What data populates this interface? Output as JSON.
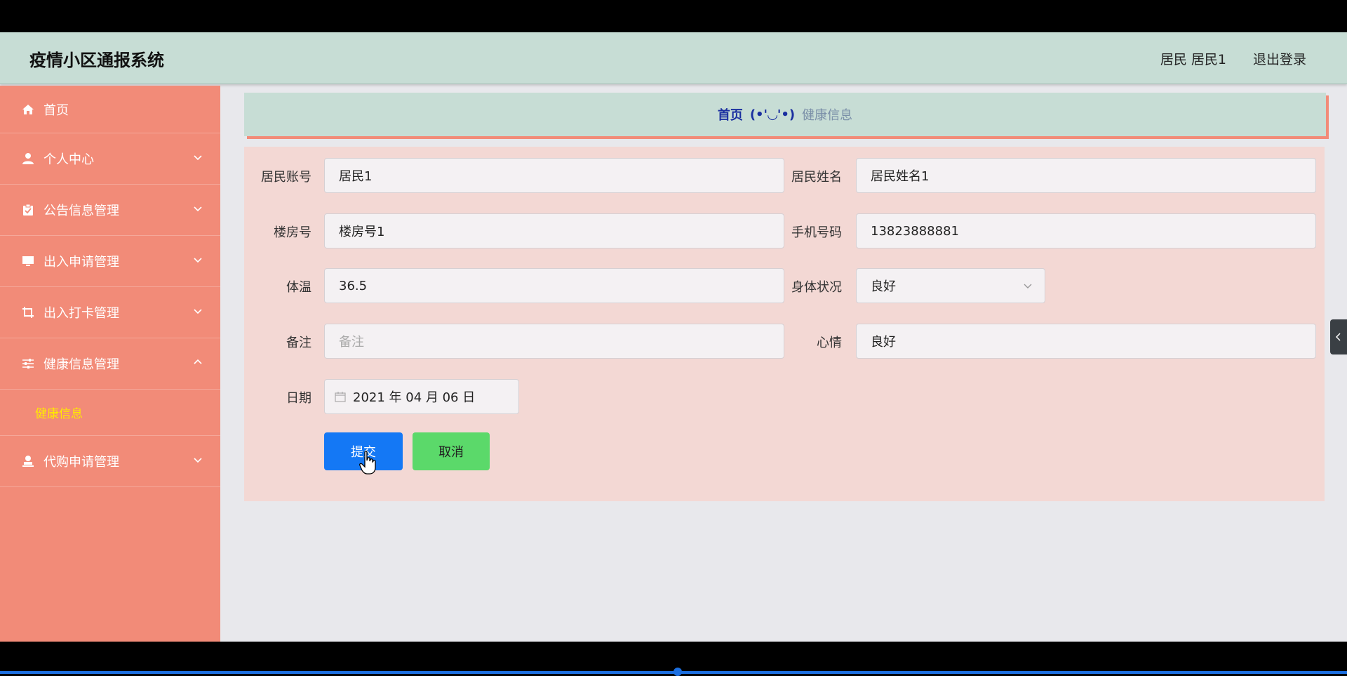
{
  "header": {
    "app_title": "疫情小区通报系统",
    "user_info": "居民 居民1",
    "logout_label": "退出登录"
  },
  "sidebar": {
    "items": [
      {
        "label": "首页",
        "icon": "home-icon"
      },
      {
        "label": "个人中心",
        "icon": "person-icon"
      },
      {
        "label": "公告信息管理",
        "icon": "clipboard-icon"
      },
      {
        "label": "出入申请管理",
        "icon": "monitor-icon"
      },
      {
        "label": "出入打卡管理",
        "icon": "crop-icon"
      },
      {
        "label": "健康信息管理",
        "icon": "sliders-icon",
        "expanded": true
      },
      {
        "label": "代购申请管理",
        "icon": "user-stamp-icon"
      }
    ],
    "active_sub": "健康信息"
  },
  "breadcrumb": {
    "home": "首页",
    "separator": "(•'◡'•)",
    "current": "健康信息"
  },
  "form": {
    "account_label": "居民账号",
    "account_value": "居民1",
    "name_label": "居民姓名",
    "name_value": "居民姓名1",
    "building_label": "楼房号",
    "building_value": "楼房号1",
    "phone_label": "手机号码",
    "phone_value": "13823888881",
    "temp_label": "体温",
    "temp_value": "36.5",
    "health_label": "身体状况",
    "health_value": "良好",
    "remark_label": "备注",
    "remark_placeholder": "备注",
    "mood_label": "心情",
    "mood_value": "良好",
    "date_label": "日期",
    "date_value": "2021 年 04 月 06 日",
    "submit_label": "提交",
    "cancel_label": "取消"
  },
  "colors": {
    "header_bg": "#c7ddd5",
    "sidebar_bg": "#f28b78",
    "active_sub": "#ffea00",
    "panel_bg": "#f3d8d4",
    "submit": "#1478f5",
    "cancel": "#5bd96a"
  }
}
